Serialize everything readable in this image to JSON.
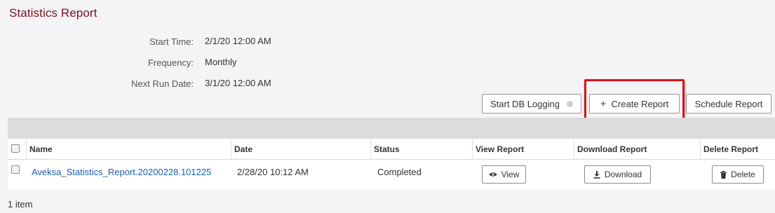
{
  "page": {
    "title": "Statistics Report"
  },
  "schedule": {
    "start_time_label": "Start Time:",
    "start_time_value": "2/1/20 12:00 AM",
    "frequency_label": "Frequency:",
    "frequency_value": "Monthly",
    "next_run_label": "Next Run Date:",
    "next_run_value": "3/1/20 12:00 AM"
  },
  "toolbar": {
    "start_db_logging_label": "Start DB Logging",
    "create_report_label": "Create Report",
    "schedule_report_label": "Schedule Report"
  },
  "table": {
    "columns": [
      "Name",
      "Date",
      "Status",
      "View Report",
      "Download Report",
      "Delete Report"
    ],
    "rows": [
      {
        "name": "Aveksa_Statistics_Report.20200228.101225",
        "date": "2/28/20 10:12 AM",
        "status": "Completed",
        "view_label": "View",
        "download_label": "Download",
        "delete_label": "Delete"
      }
    ]
  },
  "footer": {
    "item_count": "1 item"
  },
  "colors": {
    "title": "#7a1022",
    "link": "#1a5ea8",
    "highlight": "#d4151a"
  },
  "icons": {
    "view": "eye-icon",
    "download": "download-icon",
    "delete": "trash-icon",
    "create": "plus-icon",
    "logging_status": "status-dot-icon"
  }
}
